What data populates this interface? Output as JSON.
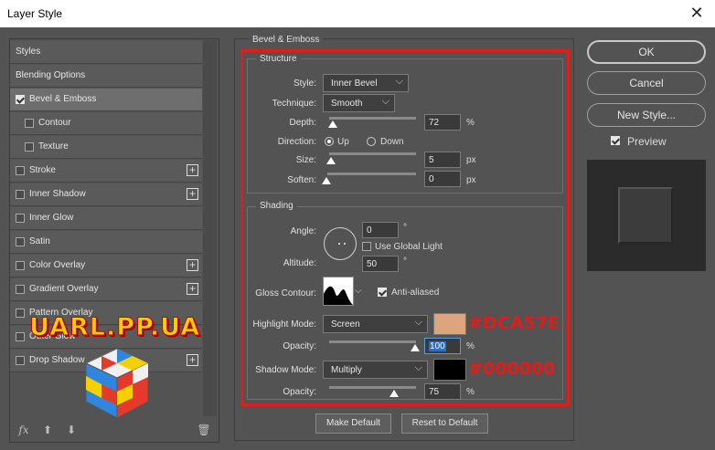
{
  "window": {
    "title": "Layer Style",
    "close_glyph": "✕"
  },
  "sidebar": {
    "items": [
      {
        "label": "Styles"
      },
      {
        "label": "Blending Options"
      },
      {
        "label": "Bevel & Emboss"
      },
      {
        "label": "Contour"
      },
      {
        "label": "Texture"
      },
      {
        "label": "Stroke"
      },
      {
        "label": "Inner Shadow"
      },
      {
        "label": "Inner Glow"
      },
      {
        "label": "Satin"
      },
      {
        "label": "Color Overlay"
      },
      {
        "label": "Gradient Overlay"
      },
      {
        "label": "Pattern Overlay"
      },
      {
        "label": "Outer Glow"
      },
      {
        "label": "Drop Shadow"
      }
    ],
    "plus_glyph": "+",
    "fx_label": "fx",
    "up_glyph": "⬆",
    "down_glyph": "⬇",
    "trash_glyph": "🗑",
    "icons": [
      "fx-icon",
      "move-up-icon",
      "move-down-icon",
      "trash-icon"
    ]
  },
  "watermark": {
    "text": "UARL.PP.UA"
  },
  "bevel": {
    "title": "Bevel & Emboss",
    "structure": {
      "title": "Structure",
      "style_label": "Style:",
      "style_value": "Inner Bevel",
      "technique_label": "Technique:",
      "technique_value": "Smooth",
      "depth_label": "Depth:",
      "depth_value": "72",
      "depth_unit": "%",
      "direction_label": "Direction:",
      "dir_up": "Up",
      "dir_down": "Down",
      "size_label": "Size:",
      "size_value": "5",
      "size_unit": "px",
      "soften_label": "Soften:",
      "soften_value": "0",
      "soften_unit": "px"
    },
    "shading": {
      "title": "Shading",
      "angle_label": "Angle:",
      "angle_value": "0",
      "degree": "°",
      "global_light_label": "Use Global Light",
      "altitude_label": "Altitude:",
      "altitude_value": "50",
      "gloss_label": "Gloss Contour:",
      "anti_aliased_label": "Anti-aliased",
      "highlight_label": "Highlight Mode:",
      "highlight_value": "Screen",
      "highlight_color": "#DCA57E",
      "highlight_color_label": "#DCA57E",
      "opacity_label": "Opacity:",
      "highlight_opacity": "100",
      "pct": "%",
      "shadow_label": "Shadow Mode:",
      "shadow_value": "Multiply",
      "shadow_color": "#000000",
      "shadow_color_label": "#000000",
      "shadow_opacity": "75"
    },
    "make_default": "Make Default",
    "reset_default": "Reset to Default"
  },
  "buttons": {
    "ok": "OK",
    "cancel": "Cancel",
    "new_style": "New Style...",
    "preview_label": "Preview"
  },
  "chevron": "⌵",
  "colors": {
    "accent_red": "#e21b1b"
  }
}
